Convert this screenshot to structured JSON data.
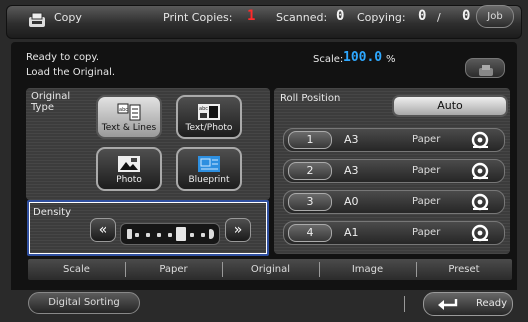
{
  "header": {
    "title": "Copy",
    "print_copies_label": "Print Copies:",
    "print_copies_value": "1",
    "scanned_label": "Scanned:",
    "scanned_value": "0",
    "copying_label": "Copying:",
    "copying_current": "0",
    "copying_separator": "/",
    "copying_total": "0",
    "job_button": "Job"
  },
  "status": {
    "line1": "Ready to copy.",
    "line2": "Load the Original.",
    "scale_label": "Scale:",
    "scale_value": "100.0",
    "scale_unit": "%"
  },
  "original_type": {
    "label_line1": "Original",
    "label_line2": "Type",
    "options": [
      {
        "label": "Text & Lines",
        "icon": "text-lines-icon",
        "selected": true
      },
      {
        "label": "Text/Photo",
        "icon": "text-photo-icon",
        "selected": false
      },
      {
        "label": "Photo",
        "icon": "photo-icon",
        "selected": false
      },
      {
        "label": "Blueprint",
        "icon": "blueprint-icon",
        "selected": false
      }
    ]
  },
  "density": {
    "label": "Density",
    "level": 5,
    "levels": 7
  },
  "roll_position": {
    "label": "Roll Position",
    "auto_button": "Auto",
    "rolls": [
      {
        "number": "1",
        "size": "A3",
        "media": "Paper"
      },
      {
        "number": "2",
        "size": "A3",
        "media": "Paper"
      },
      {
        "number": "3",
        "size": "A0",
        "media": "Paper"
      },
      {
        "number": "4",
        "size": "A1",
        "media": "Paper"
      }
    ]
  },
  "tabs": [
    "Scale",
    "Paper",
    "Original",
    "Image",
    "Preset"
  ],
  "footer": {
    "digital_sorting": "Digital Sorting",
    "ready": "Ready"
  },
  "colors": {
    "counter_red": "#ff2a2a",
    "density_highlight": "#2f4fa0"
  }
}
